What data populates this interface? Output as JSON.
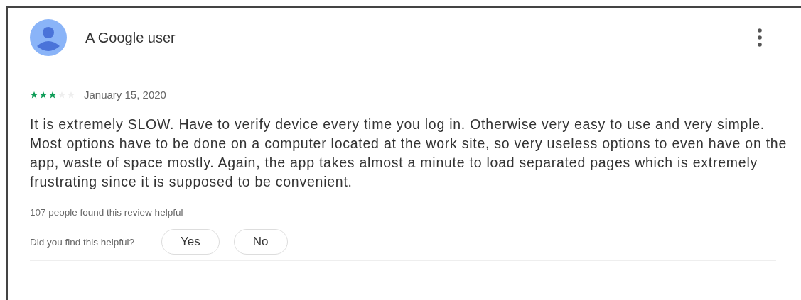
{
  "review": {
    "author": "A Google user",
    "stars": 3,
    "date": "January 15, 2020",
    "text": "It is extremely SLOW. Have to verify device every time you log in. Otherwise very easy to use and very simple. Most options have to be done on a computer located at the work site, so very useless options to even have on the app, waste of space mostly. Again, the app takes almost a minute to load separated pages which is extremely frustrating since it is supposed to be convenient.",
    "helpful_count": "107 people found this review helpful",
    "helpful_prompt": "Did you find this helpful?",
    "buttons": [
      "Yes",
      "No"
    ]
  }
}
